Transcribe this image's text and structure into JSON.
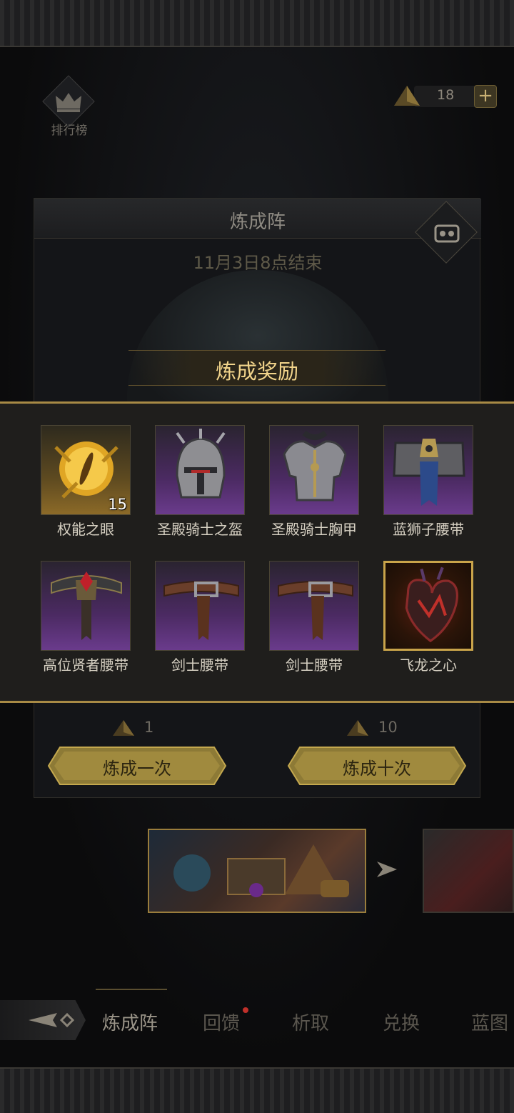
{
  "header": {
    "rank_label": "排行榜",
    "currency_value": "18",
    "currency_add": "+"
  },
  "event": {
    "title": "炼成阵",
    "end_time": "11月3日8点结束"
  },
  "rewards": {
    "title": "炼成奖励",
    "items": [
      {
        "name": "权能之眼",
        "count": "15",
        "rarity": "orange",
        "icon": "eye-gem-icon"
      },
      {
        "name": "圣殿骑士之盔",
        "count": "",
        "rarity": "purple",
        "icon": "helmet-icon"
      },
      {
        "name": "圣殿骑士胸甲",
        "count": "",
        "rarity": "purple",
        "icon": "chest-armor-icon"
      },
      {
        "name": "蓝狮子腰带",
        "count": "",
        "rarity": "purple",
        "icon": "belt-icon"
      },
      {
        "name": "高位贤者腰带",
        "count": "",
        "rarity": "purple",
        "icon": "jeweled-belt-icon"
      },
      {
        "name": "剑士腰带",
        "count": "",
        "rarity": "purple",
        "icon": "leather-belt-icon"
      },
      {
        "name": "剑士腰带",
        "count": "",
        "rarity": "purple",
        "icon": "leather-belt-icon"
      },
      {
        "name": "飞龙之心",
        "count": "",
        "rarity": "gold",
        "icon": "dragon-heart-icon"
      }
    ]
  },
  "actions": {
    "single": {
      "cost": "1",
      "label": "炼成一次"
    },
    "ten": {
      "cost": "10",
      "label": "炼成十次"
    }
  },
  "tabs": [
    {
      "label": "炼成阵",
      "active": true
    },
    {
      "label": "回馈",
      "active": false,
      "has_dot": true
    },
    {
      "label": "析取",
      "active": false
    },
    {
      "label": "兑换",
      "active": false
    },
    {
      "label": "蓝图",
      "active": false
    }
  ],
  "colors": {
    "gold_accent": "#a88a45",
    "reward_title": "#f1d48b",
    "purple_rarity": "#6a3b8c",
    "notification_dot": "#c0302a"
  }
}
